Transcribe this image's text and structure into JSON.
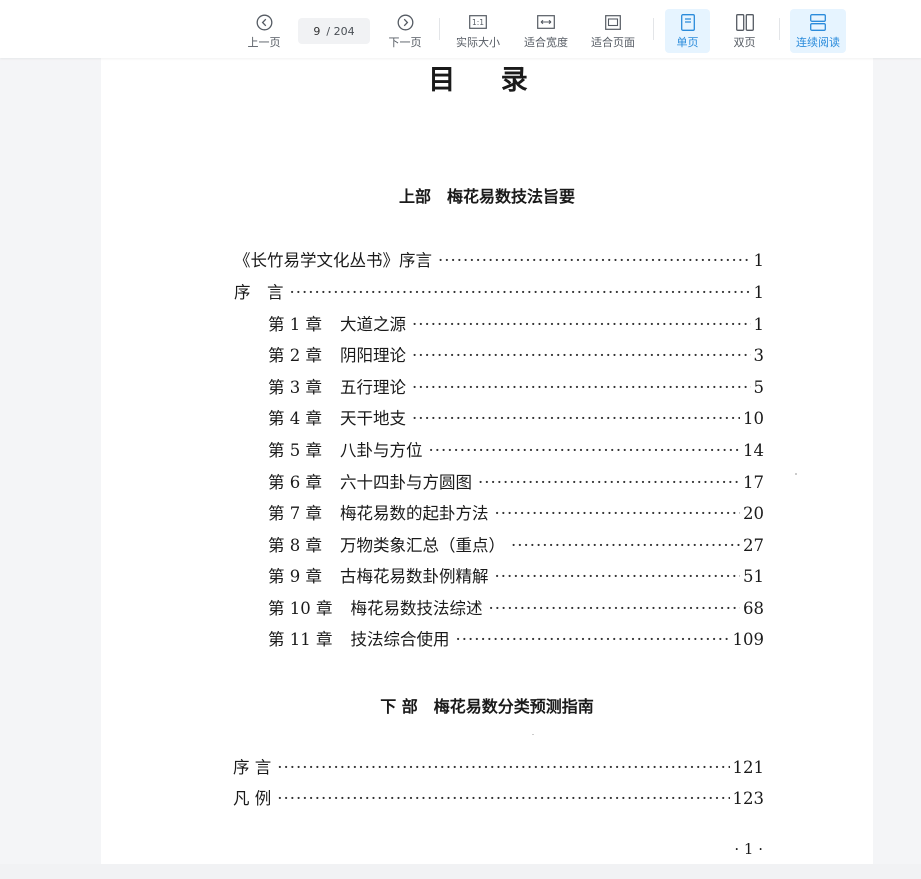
{
  "toolbar": {
    "prev_label": "上一页",
    "page_current": "9",
    "page_total": "/ 204",
    "next_label": "下一页",
    "actual_size_label": "实际大小",
    "fit_width_label": "适合宽度",
    "fit_page_label": "适合页面",
    "single_page_label": "单页",
    "double_page_label": "双页",
    "continuous_label": "连续阅读",
    "icons": {
      "prev": "chevron-left-circle-icon",
      "next": "chevron-right-circle-icon",
      "actual_size": "one-to-one-icon",
      "fit_width": "fit-width-icon",
      "fit_page": "fit-page-icon",
      "single": "single-page-icon",
      "double": "double-page-icon",
      "continuous": "continuous-scroll-icon"
    },
    "accent_color": "#2a8bdb"
  },
  "document": {
    "title": "目 录",
    "part1_title": "上部　梅花易数技法旨要",
    "part1_entries": [
      {
        "chapter": "《长竹易学文化丛书》序言",
        "title": "",
        "page": "1"
      },
      {
        "chapter": "序　言",
        "title": "",
        "page": "1"
      },
      {
        "chapter": "第 1 章",
        "title": "大道之源",
        "page": "1"
      },
      {
        "chapter": "第 2 章",
        "title": "阴阳理论",
        "page": "3"
      },
      {
        "chapter": "第 3 章",
        "title": "五行理论",
        "page": "5"
      },
      {
        "chapter": "第 4 章",
        "title": "天干地支",
        "page": "10"
      },
      {
        "chapter": "第 5 章",
        "title": "八卦与方位",
        "page": "14"
      },
      {
        "chapter": "第 6 章",
        "title": "六十四卦与方圆图",
        "page": "17"
      },
      {
        "chapter": "第 7 章",
        "title": "梅花易数的起卦方法",
        "page": "20"
      },
      {
        "chapter": "第 8 章",
        "title": "万物类象汇总（重点）",
        "page": "27"
      },
      {
        "chapter": "第 9 章",
        "title": "古梅花易数卦例精解",
        "page": "51"
      },
      {
        "chapter": "第 10 章",
        "title": "梅花易数技法综述",
        "page": "68"
      },
      {
        "chapter": "第 11 章",
        "title": "技法综合使用",
        "page": "109"
      }
    ],
    "part2_title": "下 部　梅花易数分类预测指南",
    "part2_entries": [
      {
        "chapter": "序 言",
        "title": "",
        "page": "121"
      },
      {
        "chapter": "凡 例",
        "title": "",
        "page": "123"
      }
    ],
    "page_number": "· 1 ·"
  }
}
